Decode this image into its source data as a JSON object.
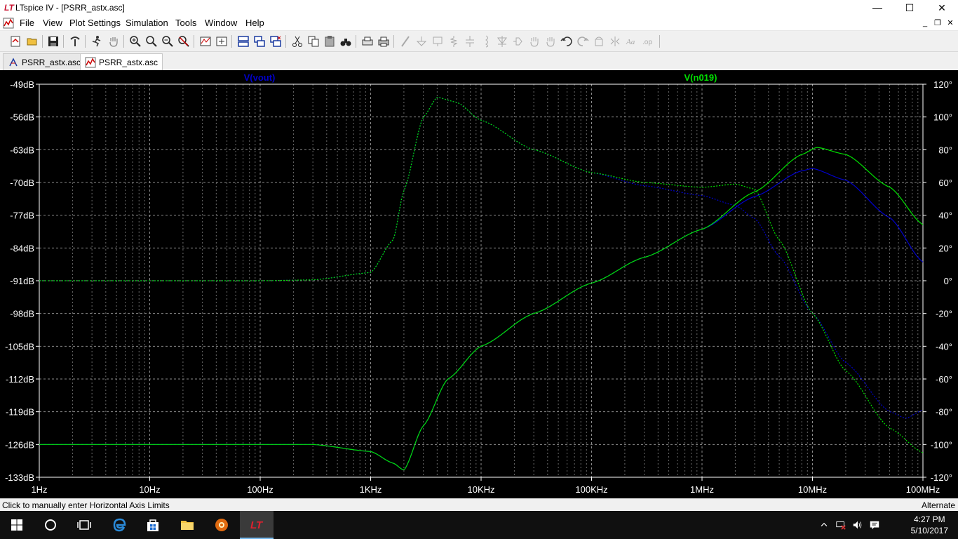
{
  "window": {
    "title": "LTspice IV - [PSRR_astx.asc]",
    "logo_text": "LT",
    "minimize": "—",
    "maximize": "☐",
    "close": "✕"
  },
  "menu": {
    "items": [
      "File",
      "View",
      "Plot Settings",
      "Simulation",
      "Tools",
      "Window",
      "Help"
    ],
    "mdi_minimize": "_",
    "mdi_restore": "❐",
    "mdi_close": "✕"
  },
  "tabs": [
    {
      "label": "PSRR_astx.asc",
      "kind": "schematic",
      "active": false
    },
    {
      "label": "PSRR_astx.asc",
      "kind": "waveform",
      "active": true
    }
  ],
  "plot": {
    "traces": [
      {
        "name": "V(vout)",
        "color": "#0000cc"
      },
      {
        "name": "V(n019)",
        "color": "#00e000"
      }
    ],
    "y_left_labels": [
      "-49dB",
      "-56dB",
      "-63dB",
      "-70dB",
      "-77dB",
      "-84dB",
      "-91dB",
      "-98dB",
      "-105dB",
      "-112dB",
      "-119dB",
      "-126dB",
      "-133dB"
    ],
    "y_right_labels": [
      "120°",
      "100°",
      "80°",
      "60°",
      "40°",
      "20°",
      "0°",
      "-20°",
      "-40°",
      "-60°",
      "-80°",
      "-100°",
      "-120°"
    ],
    "x_labels": [
      "1Hz",
      "10Hz",
      "100Hz",
      "1KHz",
      "10KHz",
      "100KHz",
      "1MHz",
      "10MHz",
      "100MHz"
    ]
  },
  "chart_data": {
    "type": "line",
    "title": "",
    "x_scale": "log",
    "xlim": [
      1,
      100000000
    ],
    "ylim_left": [
      -133,
      -49
    ],
    "ylim_right": [
      -120,
      120
    ],
    "grid": true,
    "log10_x_note_unused": "",
    "series": [
      {
        "name": "V(vout)",
        "axis": "magnitude_dB",
        "points": [
          [
            1,
            -126
          ],
          [
            100,
            -126
          ],
          [
            300,
            -126
          ],
          [
            1000,
            -127.5
          ],
          [
            1600,
            -130
          ],
          [
            2000,
            -131.5
          ],
          [
            3000,
            -122
          ],
          [
            5000,
            -112
          ],
          [
            10000,
            -105
          ],
          [
            30000,
            -98
          ],
          [
            100000,
            -91.5
          ],
          [
            300000,
            -86
          ],
          [
            1000000,
            -80
          ],
          [
            3000000,
            -73
          ],
          [
            8000000,
            -67.5
          ],
          [
            10000000,
            -67
          ],
          [
            20000000,
            -69.5
          ],
          [
            50000000,
            -77.5
          ],
          [
            100000000,
            -87
          ]
        ]
      },
      {
        "name": "V(vout)",
        "axis": "phase_deg",
        "points": [
          [
            1,
            0
          ],
          [
            100,
            0
          ],
          [
            300,
            0.5
          ],
          [
            1000,
            5
          ],
          [
            1600,
            25
          ],
          [
            2000,
            55
          ],
          [
            3000,
            100
          ],
          [
            4000,
            112
          ],
          [
            6000,
            109
          ],
          [
            10000,
            98
          ],
          [
            30000,
            80
          ],
          [
            100000,
            66
          ],
          [
            300000,
            58
          ],
          [
            1000000,
            52
          ],
          [
            2000000,
            46
          ],
          [
            3000000,
            38
          ],
          [
            5000000,
            15
          ],
          [
            10000000,
            -20
          ],
          [
            20000000,
            -50
          ],
          [
            50000000,
            -80
          ],
          [
            70000000,
            -84
          ],
          [
            100000000,
            -79
          ]
        ]
      },
      {
        "name": "V(n019)",
        "axis": "magnitude_dB",
        "points": [
          [
            1,
            -126
          ],
          [
            100,
            -126
          ],
          [
            300,
            -126
          ],
          [
            1000,
            -127.5
          ],
          [
            1600,
            -130
          ],
          [
            2000,
            -131.5
          ],
          [
            3000,
            -122
          ],
          [
            5000,
            -112
          ],
          [
            10000,
            -105
          ],
          [
            30000,
            -98
          ],
          [
            100000,
            -91.5
          ],
          [
            300000,
            -86
          ],
          [
            1000000,
            -80
          ],
          [
            3000000,
            -72
          ],
          [
            8000000,
            -64
          ],
          [
            11000000,
            -62.5
          ],
          [
            20000000,
            -64
          ],
          [
            50000000,
            -71
          ],
          [
            100000000,
            -79
          ]
        ]
      },
      {
        "name": "V(n019)",
        "axis": "phase_deg",
        "points": [
          [
            1,
            0
          ],
          [
            100,
            0
          ],
          [
            300,
            0.5
          ],
          [
            1000,
            5
          ],
          [
            1600,
            25
          ],
          [
            2000,
            55
          ],
          [
            3000,
            100
          ],
          [
            4000,
            112
          ],
          [
            6000,
            109
          ],
          [
            10000,
            98
          ],
          [
            30000,
            80
          ],
          [
            100000,
            66
          ],
          [
            300000,
            60
          ],
          [
            1000000,
            57
          ],
          [
            2000000,
            59
          ],
          [
            3000000,
            56
          ],
          [
            5000000,
            25
          ],
          [
            10000000,
            -20
          ],
          [
            20000000,
            -55
          ],
          [
            50000000,
            -90
          ],
          [
            100000000,
            -105
          ]
        ]
      }
    ]
  },
  "status": {
    "text": "Click to manually enter Horizontal Axis Limits",
    "right": "Alternate"
  },
  "clock": {
    "time": "4:27 PM",
    "date": "5/10/2017"
  }
}
